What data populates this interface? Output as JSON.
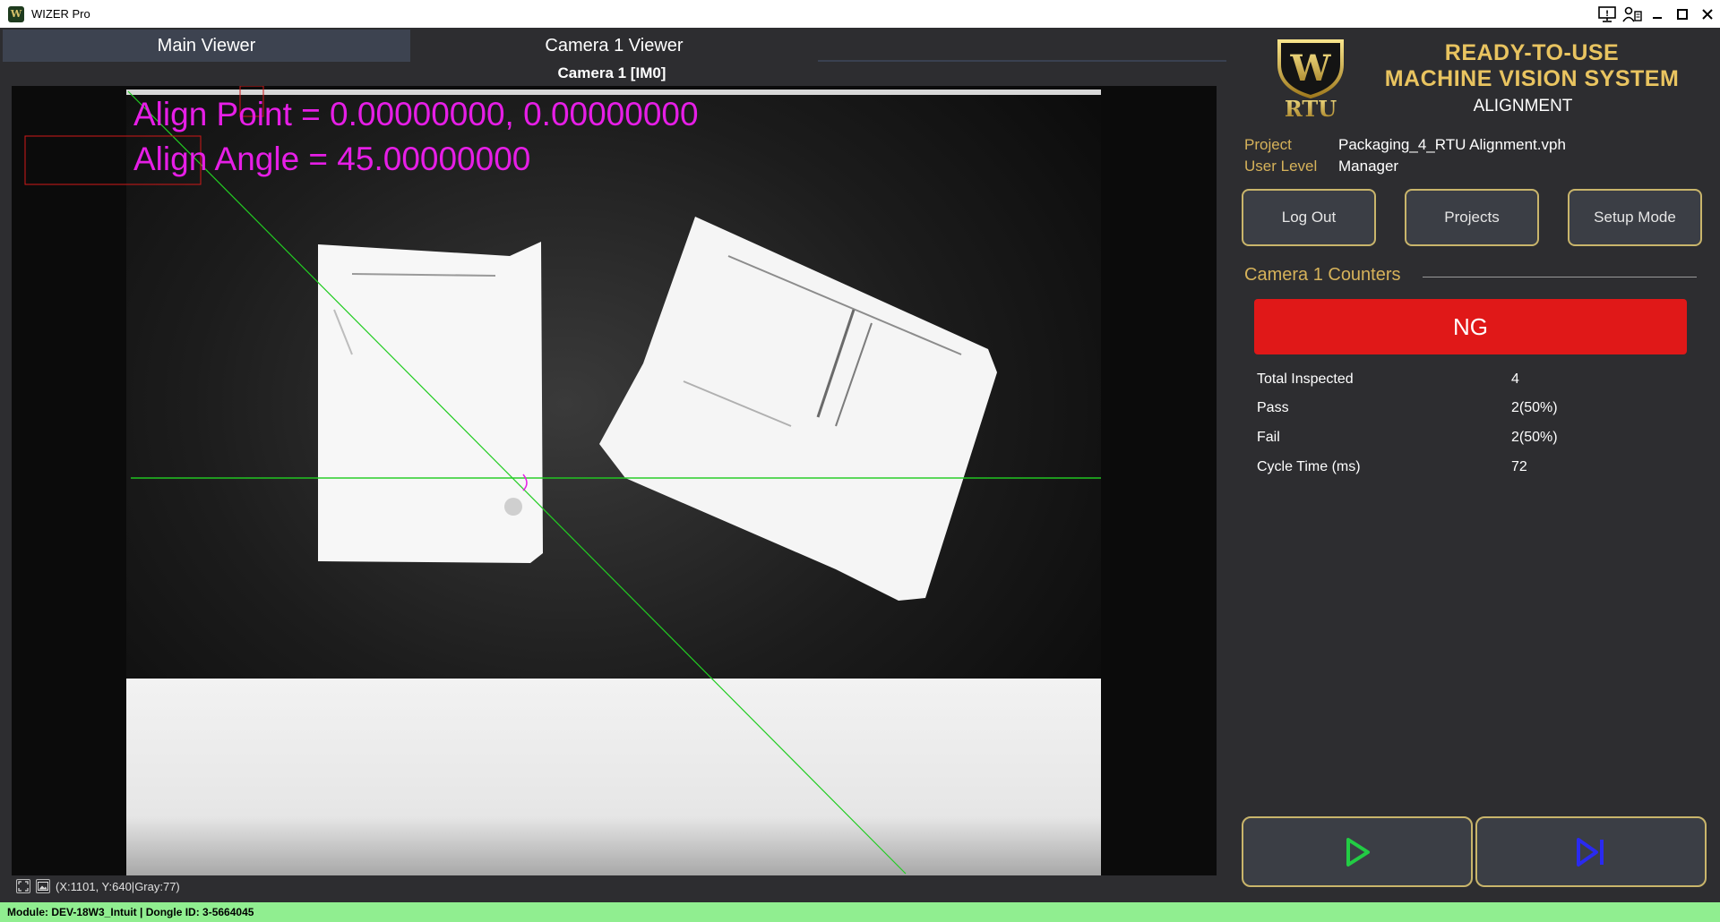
{
  "window": {
    "title": "WIZER Pro",
    "icon": "wizer-app-icon"
  },
  "tabs": [
    {
      "label": "Main Viewer",
      "active": true
    },
    {
      "label": "Camera 1 Viewer",
      "active": false
    }
  ],
  "viewer": {
    "camera_title": "Camera 1  [IM0]",
    "overlay": {
      "align_point": "Align Point = 0.00000000, 0.00000000",
      "align_angle": "Align Angle = 45.00000000"
    },
    "status": "(X:1101, Y:640|Gray:77)",
    "overlay_color": "#e61ee6",
    "line_color": "#22cc22"
  },
  "branding": {
    "line1": "READY-TO-USE",
    "line2": "MACHINE VISION SYSTEM",
    "line3": "ALIGNMENT",
    "logo_text": "RTU",
    "logo_letter": "W",
    "accent_color": "#e9c460"
  },
  "info": {
    "project_label": "Project",
    "project_value": "Packaging_4_RTU Alignment.vph",
    "user_level_label": "User Level",
    "user_level_value": "Manager"
  },
  "buttons": {
    "log_out": "Log Out",
    "projects": "Projects",
    "setup_mode": "Setup Mode"
  },
  "counters": {
    "title": "Camera 1 Counters",
    "result": "NG",
    "result_color": "#e01818",
    "rows": [
      {
        "label": "Total Inspected",
        "value": "4"
      },
      {
        "label": "Pass",
        "value": "2(50%)"
      },
      {
        "label": "Fail",
        "value": "2(50%)"
      },
      {
        "label": "Cycle Time (ms)",
        "value": "72"
      }
    ]
  },
  "controls": {
    "run_icon": "play-icon",
    "step_icon": "step-forward-icon",
    "run_color": "#22cc44",
    "step_color": "#2a2af0"
  },
  "statusbar": {
    "text": "Module: DEV-18W3_Intuit | Dongle ID: 3-5664045",
    "color": "#90ee90"
  }
}
